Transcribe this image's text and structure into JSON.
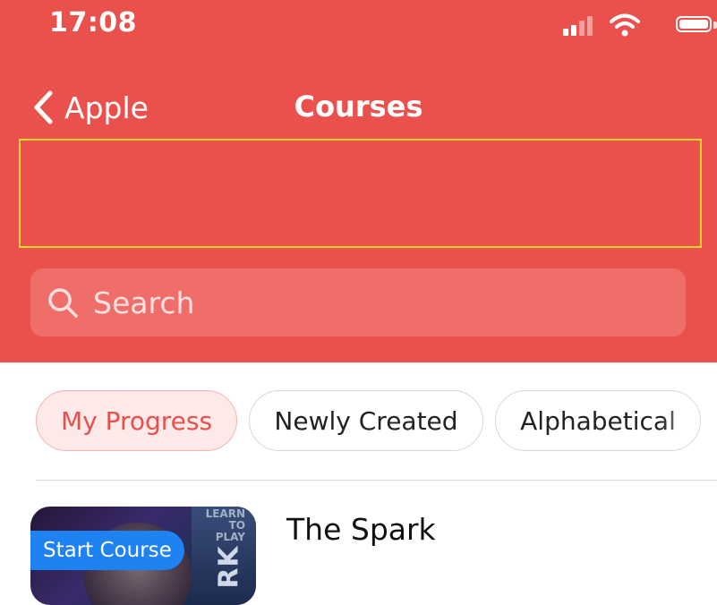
{
  "status_bar": {
    "time": "17:08",
    "icons": [
      "signal-icon",
      "wifi-icon",
      "battery-icon"
    ]
  },
  "nav": {
    "back_label": "Apple",
    "title": "Courses"
  },
  "search": {
    "placeholder": "Search"
  },
  "filters": [
    {
      "label": "My Progress",
      "active": true
    },
    {
      "label": "Newly Created",
      "active": false
    },
    {
      "label": "Alphabetical",
      "active": false
    }
  ],
  "courses": [
    {
      "title": "The Spark",
      "badge": "Start Course",
      "thumb_top_text": "LEARN TO PLAY",
      "thumb_side_text": "RK"
    }
  ],
  "colors": {
    "header": "#ea514d",
    "highlight_border": "#f5d328",
    "badge": "#1f82f2",
    "active_chip_text": "#e8504c"
  }
}
